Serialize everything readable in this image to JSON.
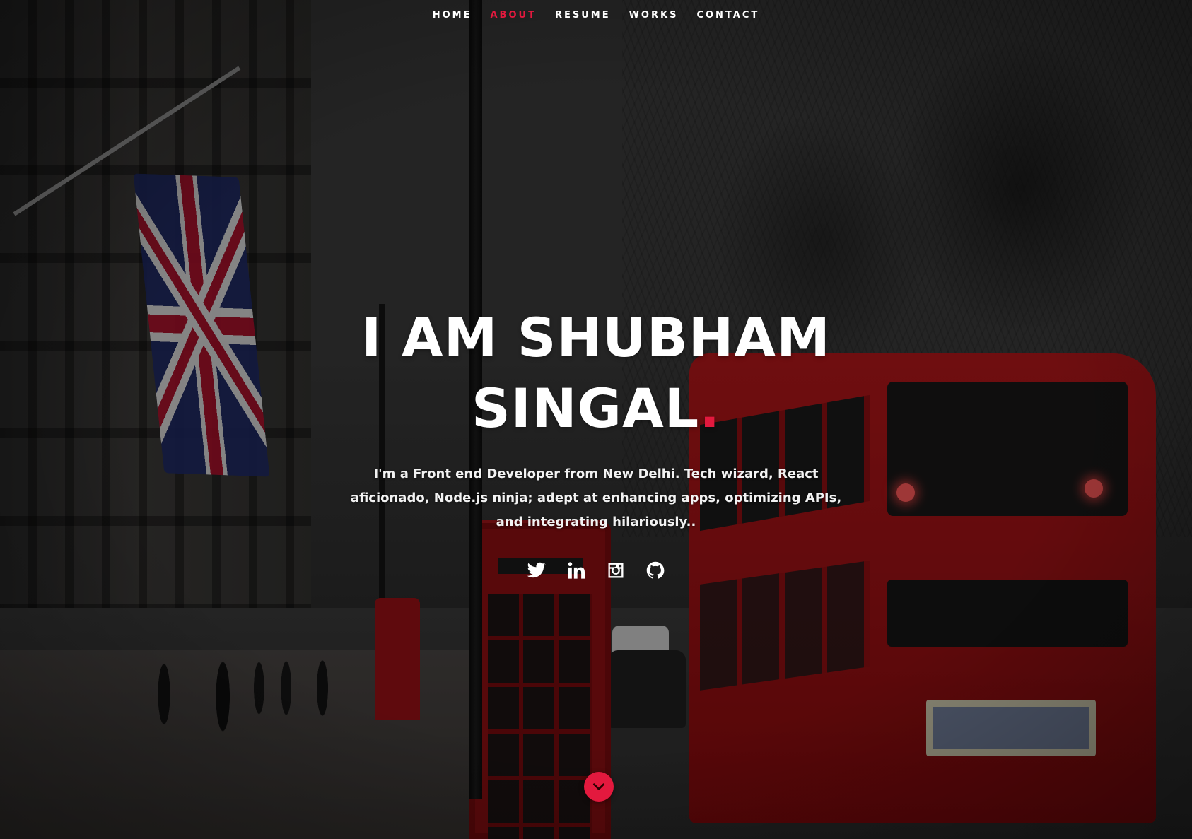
{
  "nav": {
    "items": [
      {
        "label": "HOME",
        "active": false
      },
      {
        "label": "ABOUT",
        "active": true
      },
      {
        "label": "RESUME",
        "active": false
      },
      {
        "label": "WORKS",
        "active": false
      },
      {
        "label": "CONTACT",
        "active": false
      }
    ]
  },
  "banner": {
    "headline_line1": "I AM SHUBHAM",
    "headline_line2": "SINGAL",
    "headline_dot": ".",
    "intro": "I'm a Front end Developer from New Delhi. Tech wizard, React aficionado, Node.js ninja; adept at enhancing apps, optimizing APIs, and integrating hilariously.."
  },
  "social": {
    "icons": [
      "twitter-icon",
      "linkedin-icon",
      "instagram-icon",
      "github-icon"
    ]
  },
  "scroll_down": {
    "icon": "chevron-down-icon"
  },
  "colors": {
    "accent": "#e3193e",
    "text": "#ffffff",
    "overlay": "rgba(0,0,0,0.38)"
  }
}
